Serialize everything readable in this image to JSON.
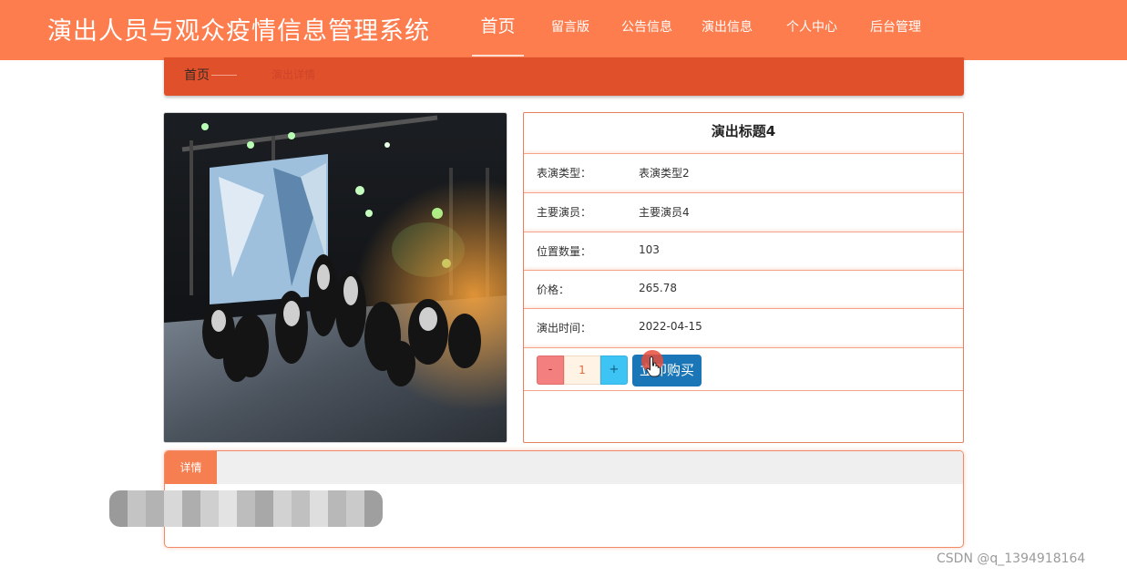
{
  "header": {
    "site_title": "演出人员与观众疫情信息管理系统",
    "nav": [
      {
        "label": "首页",
        "active": true
      },
      {
        "label": "留言版",
        "active": false
      },
      {
        "label": "公告信息",
        "active": false
      },
      {
        "label": "演出信息",
        "active": false
      },
      {
        "label": "个人中心",
        "active": false
      },
      {
        "label": "后台管理",
        "active": false
      }
    ]
  },
  "breadcrumb": {
    "home": "首页",
    "current": "演出详情"
  },
  "detail": {
    "title": "演出标题4",
    "rows": [
      {
        "label": "表演类型：",
        "value": "表演类型2"
      },
      {
        "label": "主要演员：",
        "value": "主要演员4"
      },
      {
        "label": "位置数量：",
        "value": "103"
      },
      {
        "label": "价格：",
        "value": "265.78"
      },
      {
        "label": "演出时间：",
        "value": "2022-04-15"
      }
    ],
    "quantity": {
      "minus": "-",
      "value": "1",
      "plus": "+"
    },
    "buy_label": "立即购买"
  },
  "tabs": {
    "details_label": "详情"
  },
  "watermark": "CSDN @q_1394918164",
  "colors": {
    "header": "#fd7d4e",
    "breadcrumb": "#e0502a",
    "buy_button": "#1a76b6",
    "minus": "#f47f7f",
    "plus": "#3ec4f4",
    "tab": "#f57f51"
  },
  "icons": {
    "cursor": "hand-pointer-icon"
  }
}
